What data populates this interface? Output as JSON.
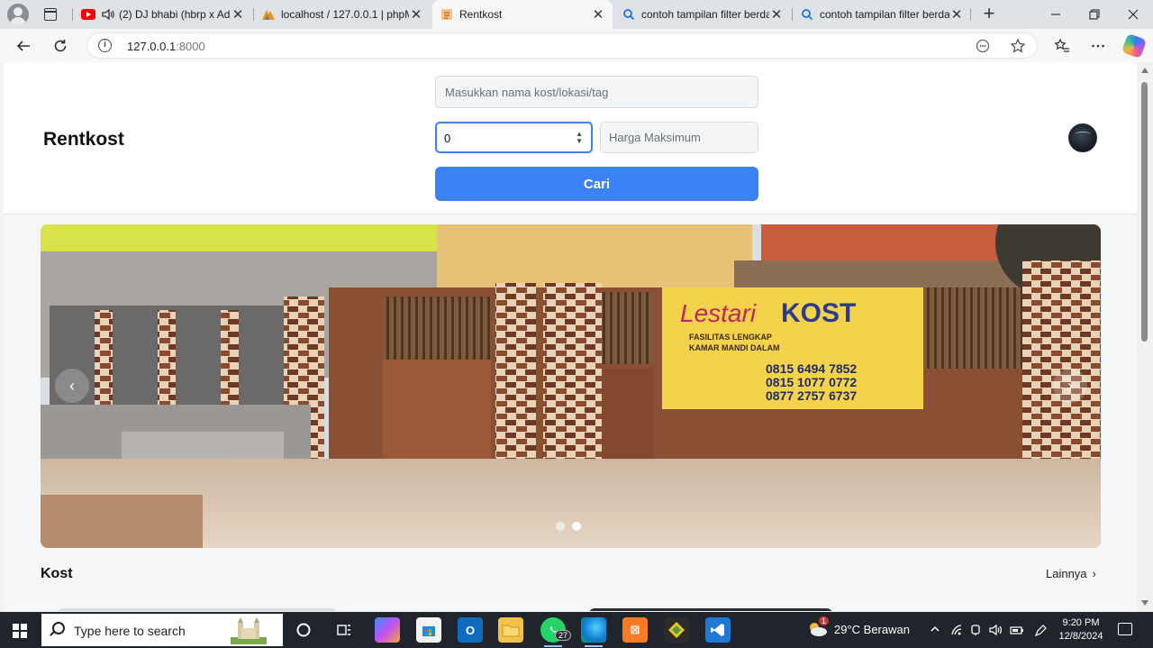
{
  "browser": {
    "tabs": [
      {
        "title": "(2) DJ bhabi (hbrp x Adr",
        "favicon": "youtube-icon",
        "muted_icon": "speaker-icon"
      },
      {
        "title": "localhost / 127.0.0.1 | phpMy",
        "favicon": "phpmyadmin-icon"
      },
      {
        "title": "Rentkost",
        "favicon": "page-icon",
        "active": true
      },
      {
        "title": "contoh tampilan filter berda",
        "favicon": "search-icon"
      },
      {
        "title": "contoh tampilan filter berda",
        "favicon": "search-icon"
      }
    ],
    "close_glyph": "✕",
    "new_tab_glyph": "+",
    "address": {
      "host": "127.0.0.1",
      "port": ":8000"
    }
  },
  "site": {
    "brand": "Rentkost",
    "search": {
      "placeholder": "Masukkan nama kost/lokasi/tag",
      "min_price_value": "0",
      "max_price_placeholder": "Harga Maksimum",
      "button_label": "Cari"
    },
    "carousel": {
      "slides": 2,
      "active_slide": 2,
      "banner": {
        "brand_a": "Lestari",
        "brand_b": "KOST",
        "feature_1": "FASILITAS LENGKAP",
        "feature_2": "KAMAR MANDI DALAM",
        "phone_1": "0815 6494 7852",
        "phone_2": "0815 1077 0772",
        "phone_3": "0877 2757 6737"
      },
      "prev_glyph": "‹",
      "next_glyph": "›"
    },
    "section": {
      "title": "Kost",
      "more_label": "Lainnya"
    }
  },
  "taskbar": {
    "search_placeholder": "Type here to search",
    "whatsapp_badge": "27",
    "weather": "29°C  Berawan",
    "weather_badge": "1",
    "time": "9:20 PM",
    "date": "12/8/2024"
  },
  "colors": {
    "primary": "#3b82f6",
    "taskbar": "#20252b"
  }
}
